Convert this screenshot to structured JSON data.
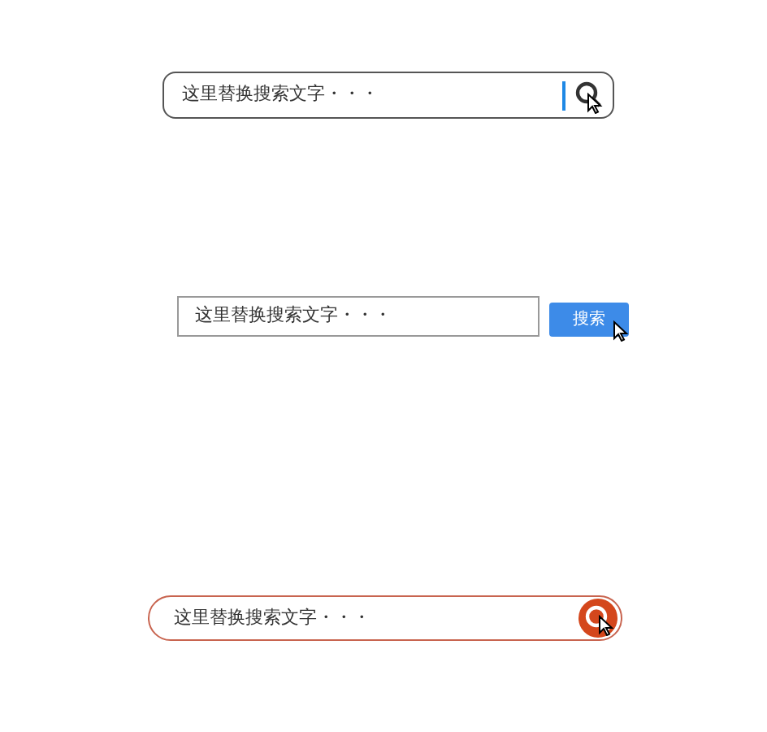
{
  "search_bars": [
    {
      "kind": "outlined",
      "placeholder": "这里替换搜索文字・・・"
    },
    {
      "kind": "button",
      "placeholder": "这里替换搜索文字・・・",
      "button": "搜索"
    },
    {
      "kind": "pill",
      "placeholder": "这里替换搜索文字・・・"
    }
  ]
}
